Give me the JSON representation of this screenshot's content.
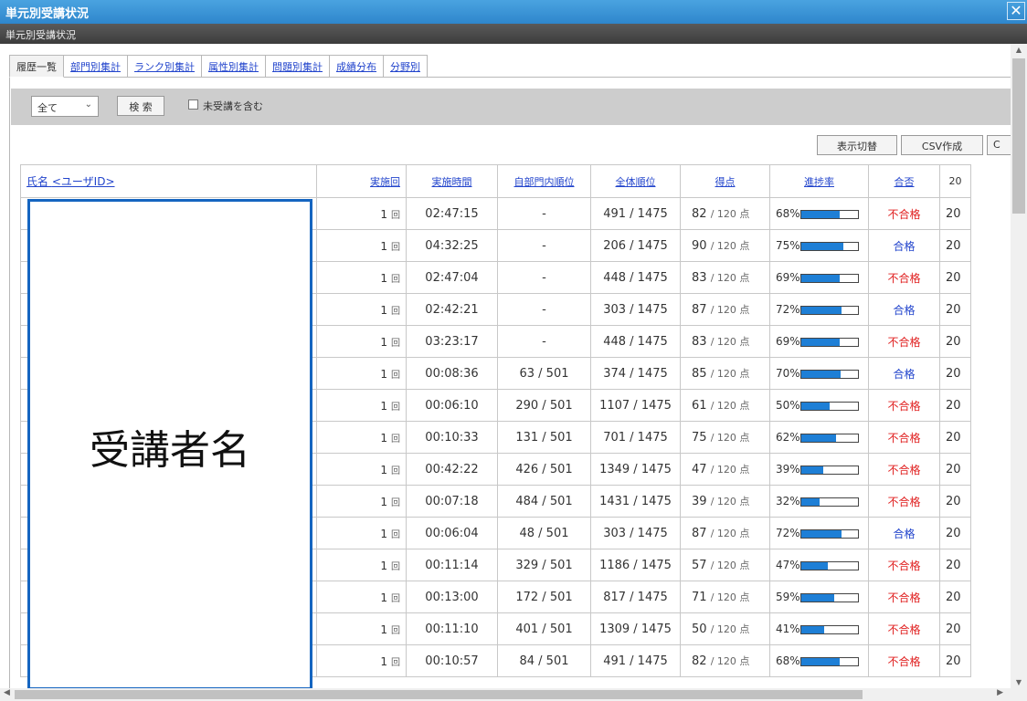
{
  "window": {
    "title": "単元別受講状況",
    "close_icon": "close-icon"
  },
  "subheader": {
    "title": "単元別受講状況"
  },
  "tabs": [
    "履歴一覧",
    "部門別集計",
    "ランク別集計",
    "属性別集計",
    "問題別集計",
    "成績分布",
    "分野別"
  ],
  "search": {
    "select_value": "全て",
    "search_button": "検 索",
    "checkbox_label": "未受講を含む"
  },
  "toolbar": {
    "toggle_button": "表示切替",
    "csv_button": "CSV作成",
    "third_button": "C"
  },
  "table": {
    "headers": {
      "name": "氏名",
      "userid": "<ユーザID>",
      "count": "実施回",
      "time": "実施時間",
      "dept_rank": "自部門内順位",
      "overall_rank": "全体順位",
      "score": "得点",
      "progress": "進捗率",
      "result": "合否",
      "date": "20"
    },
    "count_unit": "回",
    "score_unit": "/ 120 点",
    "rows": [
      {
        "count": "1",
        "time": "02:47:15",
        "dept_rank": "-",
        "overall_rank": "491 / 1475",
        "score": "82",
        "progress": "68%",
        "result": "不合格",
        "date": "20"
      },
      {
        "count": "1",
        "time": "04:32:25",
        "dept_rank": "-",
        "overall_rank": "206 / 1475",
        "score": "90",
        "progress": "75%",
        "result": "合格",
        "date": "20"
      },
      {
        "count": "1",
        "time": "02:47:04",
        "dept_rank": "-",
        "overall_rank": "448 / 1475",
        "score": "83",
        "progress": "69%",
        "result": "不合格",
        "date": "20"
      },
      {
        "count": "1",
        "time": "02:42:21",
        "dept_rank": "-",
        "overall_rank": "303 / 1475",
        "score": "87",
        "progress": "72%",
        "result": "合格",
        "date": "20"
      },
      {
        "count": "1",
        "time": "03:23:17",
        "dept_rank": "-",
        "overall_rank": "448 / 1475",
        "score": "83",
        "progress": "69%",
        "result": "不合格",
        "date": "20"
      },
      {
        "count": "1",
        "time": "00:08:36",
        "dept_rank": "63 / 501",
        "overall_rank": "374 / 1475",
        "score": "85",
        "progress": "70%",
        "result": "合格",
        "date": "20"
      },
      {
        "count": "1",
        "time": "00:06:10",
        "dept_rank": "290 / 501",
        "overall_rank": "1107 / 1475",
        "score": "61",
        "progress": "50%",
        "result": "不合格",
        "date": "20"
      },
      {
        "count": "1",
        "time": "00:10:33",
        "dept_rank": "131 / 501",
        "overall_rank": "701 / 1475",
        "score": "75",
        "progress": "62%",
        "result": "不合格",
        "date": "20"
      },
      {
        "count": "1",
        "time": "00:42:22",
        "dept_rank": "426 / 501",
        "overall_rank": "1349 / 1475",
        "score": "47",
        "progress": "39%",
        "result": "不合格",
        "date": "20"
      },
      {
        "count": "1",
        "time": "00:07:18",
        "dept_rank": "484 / 501",
        "overall_rank": "1431 / 1475",
        "score": "39",
        "progress": "32%",
        "result": "不合格",
        "date": "20"
      },
      {
        "count": "1",
        "time": "00:06:04",
        "dept_rank": "48 / 501",
        "overall_rank": "303 / 1475",
        "score": "87",
        "progress": "72%",
        "result": "合格",
        "date": "20"
      },
      {
        "count": "1",
        "time": "00:11:14",
        "dept_rank": "329 / 501",
        "overall_rank": "1186 / 1475",
        "score": "57",
        "progress": "47%",
        "result": "不合格",
        "date": "20"
      },
      {
        "count": "1",
        "time": "00:13:00",
        "dept_rank": "172 / 501",
        "overall_rank": "817 / 1475",
        "score": "71",
        "progress": "59%",
        "result": "不合格",
        "date": "20"
      },
      {
        "count": "1",
        "time": "00:11:10",
        "dept_rank": "401 / 501",
        "overall_rank": "1309 / 1475",
        "score": "50",
        "progress": "41%",
        "result": "不合格",
        "date": "20"
      },
      {
        "count": "1",
        "time": "00:10:57",
        "dept_rank": "84 / 501",
        "overall_rank": "491 / 1475",
        "score": "82",
        "progress": "68%",
        "result": "不合格",
        "date": "20"
      }
    ]
  },
  "overlay": {
    "label": "受講者名"
  },
  "colors": {
    "accent": "#1e7fd6",
    "fail": "#e02020",
    "pass": "#2244cc",
    "overlay_border": "#1565c0"
  }
}
